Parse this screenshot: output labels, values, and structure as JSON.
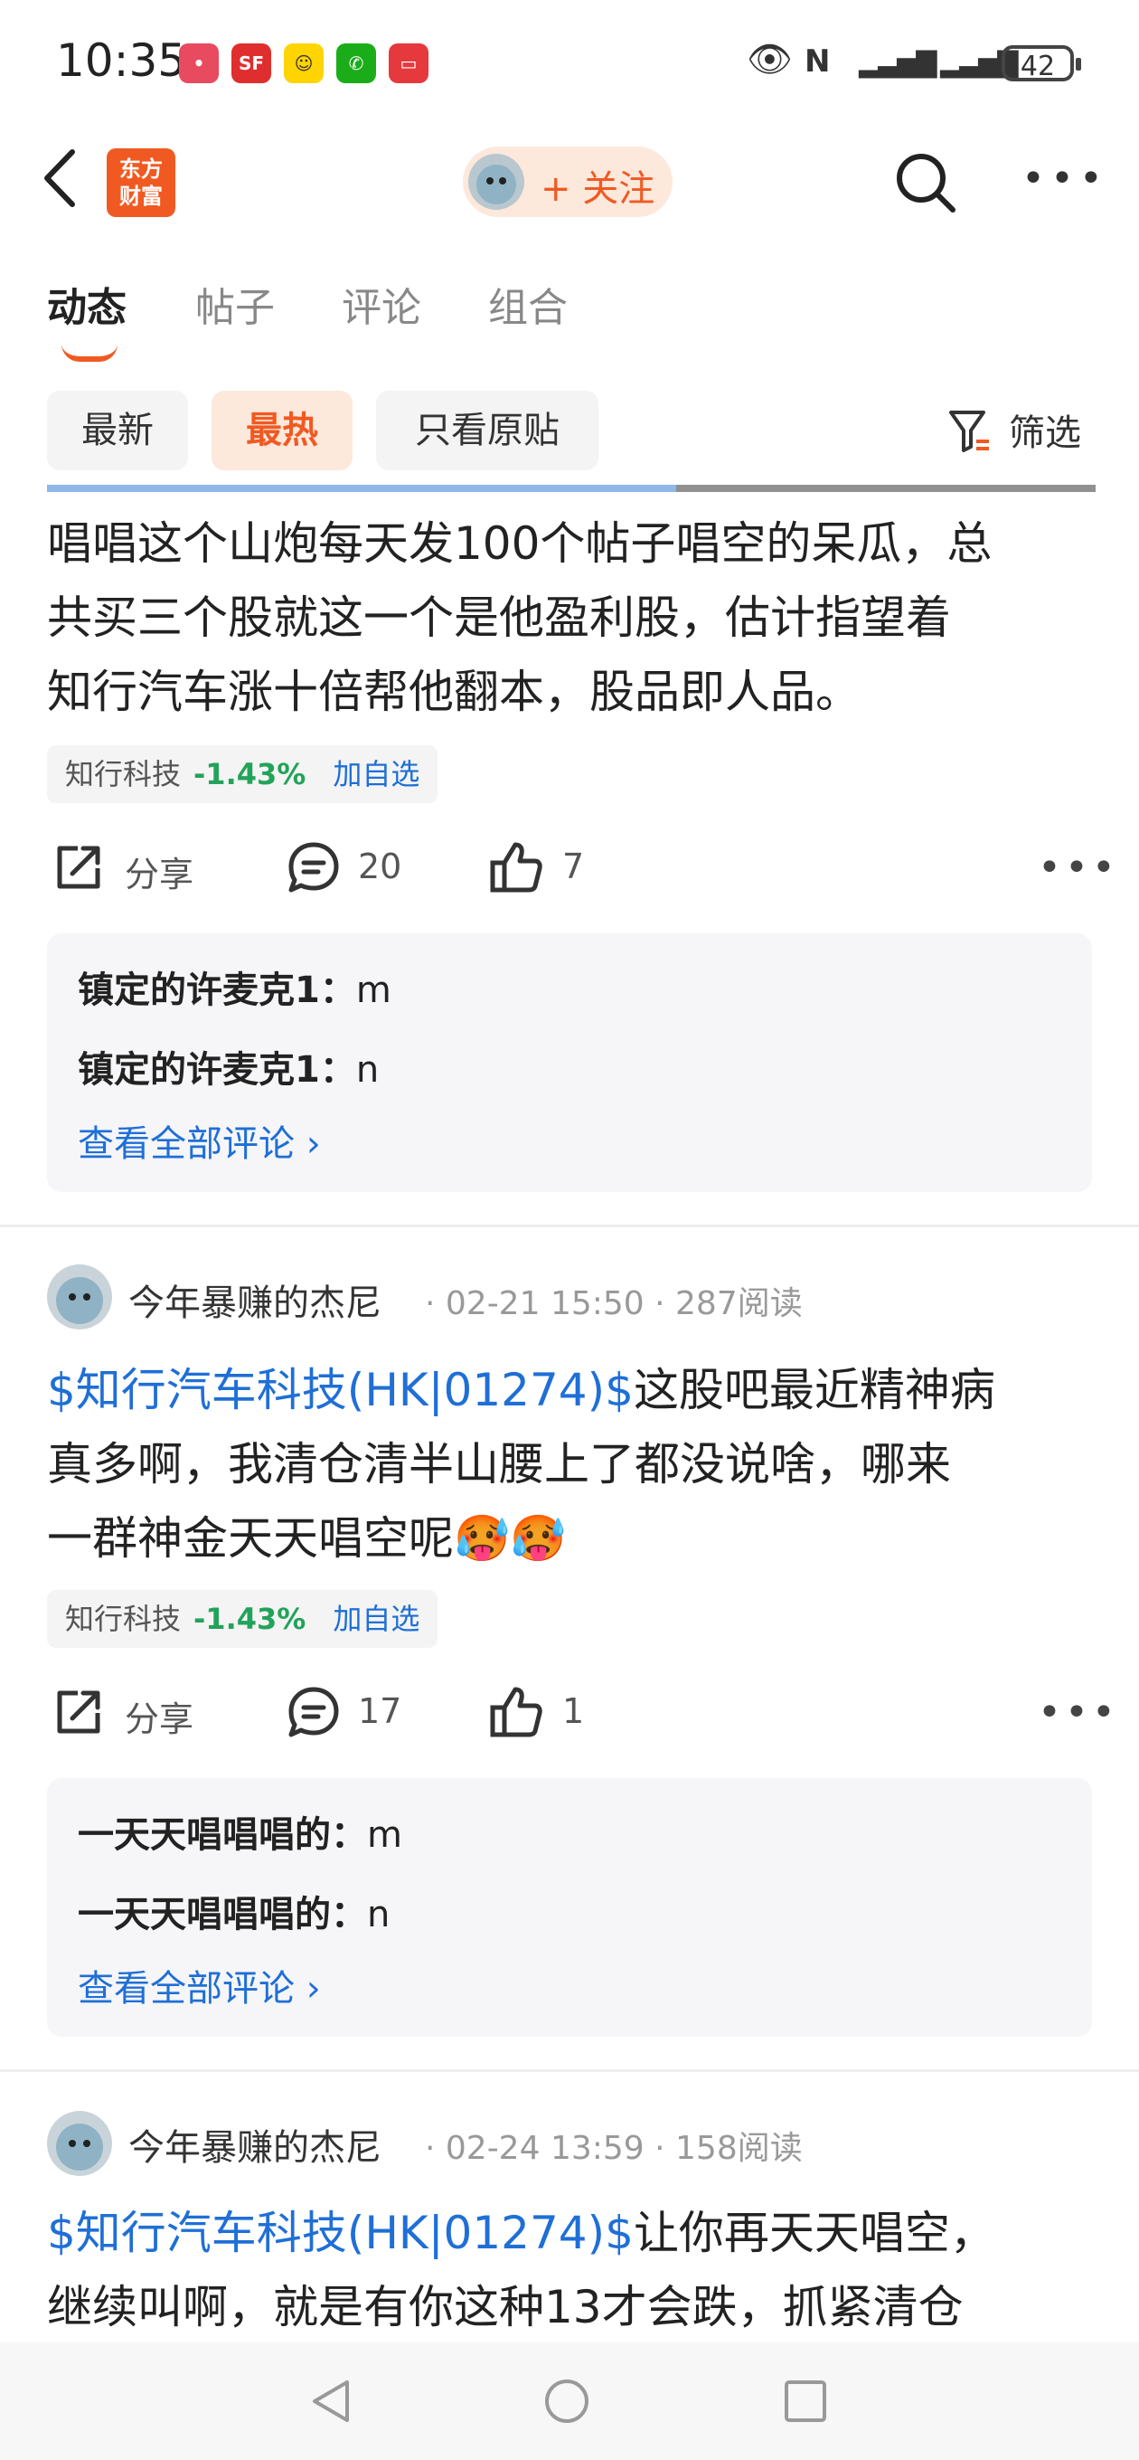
{
  "status": {
    "time": "10:35",
    "battery": "42"
  },
  "header": {
    "logo_line1": "东方",
    "logo_line2": "财富",
    "follow_label": "+ 关注"
  },
  "tabs": [
    {
      "label": "动态"
    },
    {
      "label": "帖子"
    },
    {
      "label": "评论"
    },
    {
      "label": "组合"
    }
  ],
  "chips": [
    {
      "label": "最新"
    },
    {
      "label": "最热"
    },
    {
      "label": "只看原贴"
    }
  ],
  "filter_label": "筛选",
  "posts": [
    {
      "lines": [
        "唱唱这个山炮每天发100个帖子唱空的呆瓜，总",
        "共买三个股就这一个是他盈利股，估计指望着",
        "知行汽车涨十倍帮他翻本，股品即人品。"
      ],
      "stock": {
        "name": "知行科技",
        "change": "-1.43%",
        "add": "加自选"
      },
      "share": "分享",
      "comments": "20",
      "likes": "7",
      "comment_list": [
        {
          "name": "镇定的许麦克1：",
          "text": "m"
        },
        {
          "name": "镇定的许麦克1：",
          "text": "n"
        }
      ],
      "view_all": "查看全部评论 ›"
    },
    {
      "author": "今年暴赚的杰尼",
      "meta": "· 02-21 15:50 · 287阅读",
      "link": "$知行汽车科技(HK|01274)$",
      "line1_rest": "这股吧最近精神病",
      "line2": "真多啊，我清仓清半山腰上了都没说啥，哪来",
      "line3": "一群神金天天唱空呢🥵🥵",
      "stock": {
        "name": "知行科技",
        "change": "-1.43%",
        "add": "加自选"
      },
      "share": "分享",
      "comments": "17",
      "likes": "1",
      "comment_list": [
        {
          "name": "一天天唱唱唱的：",
          "text": "m"
        },
        {
          "name": "一天天唱唱唱的：",
          "text": "n"
        }
      ],
      "view_all": "查看全部评论 ›"
    },
    {
      "author": "今年暴赚的杰尼",
      "meta": "· 02-24 13:59 · 158阅读",
      "link": "$知行汽车科技(HK|01274)$",
      "line1_rest": "让你再天天唱空，",
      "line2": "继续叫啊，就是有你这种13才会跌，抓紧清仓"
    }
  ]
}
